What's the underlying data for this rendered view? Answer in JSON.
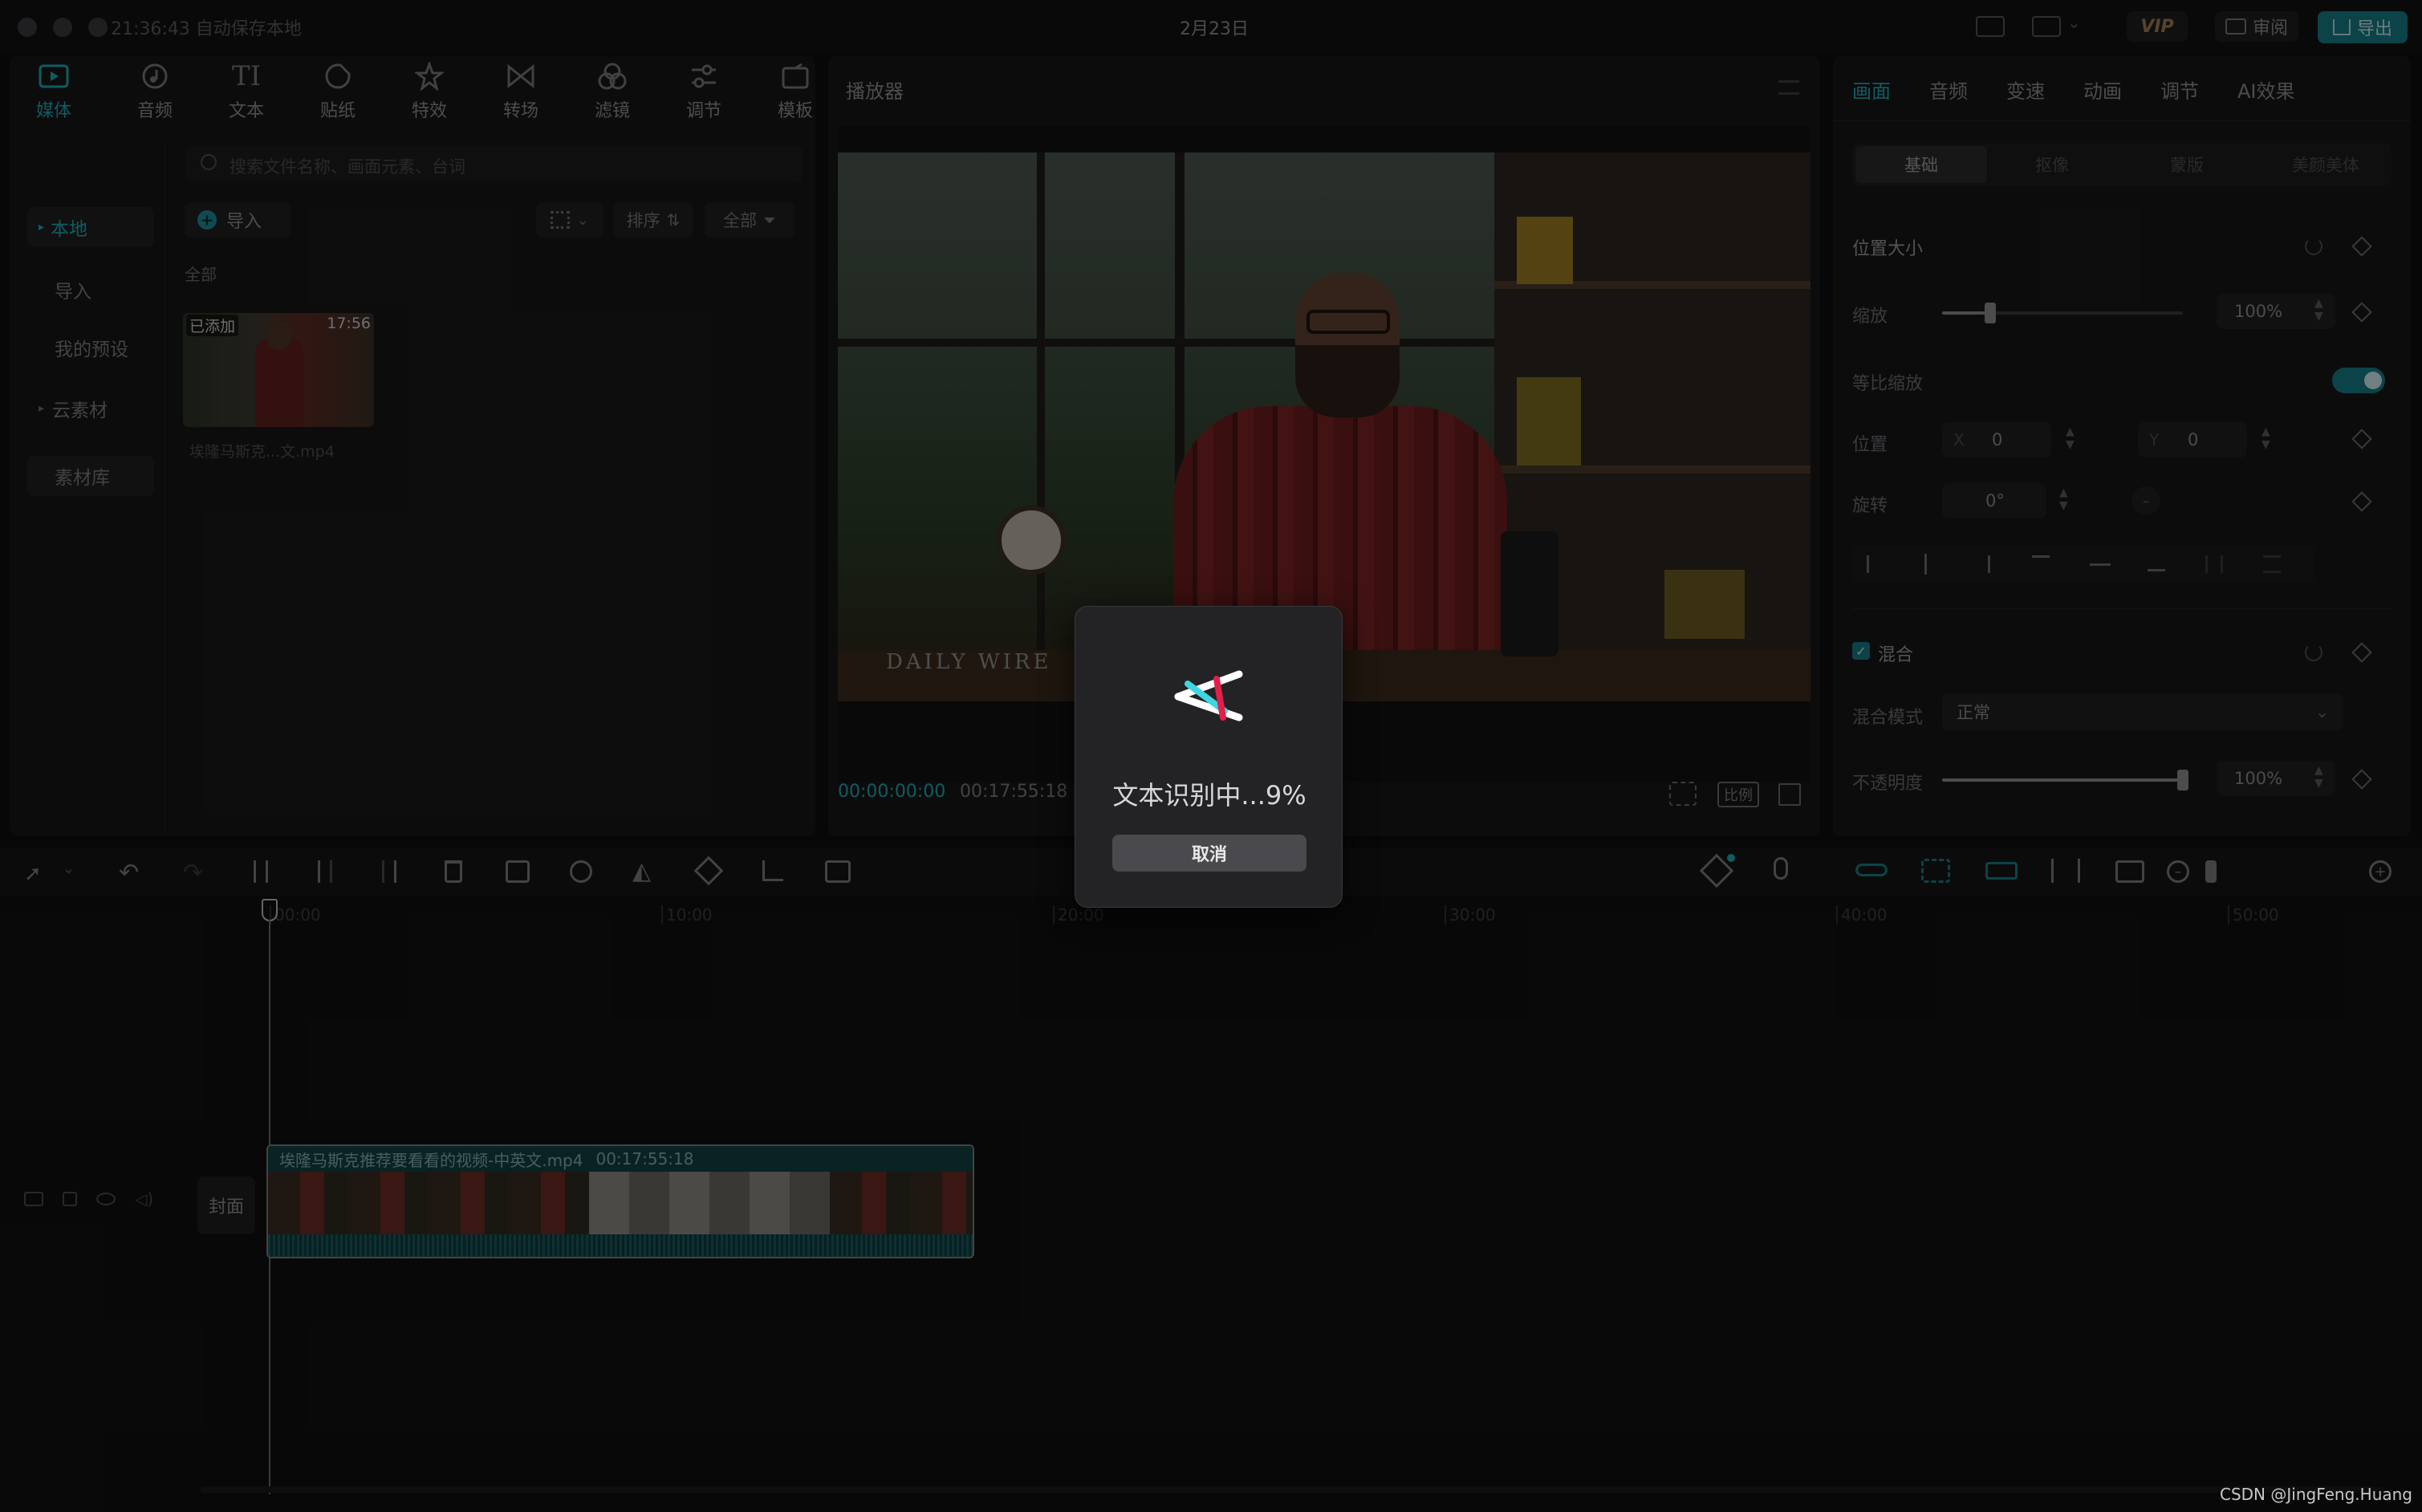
{
  "titlebar": {
    "autosave": "21:36:43 自动保存本地",
    "title": "2月23日",
    "vip": "VIP",
    "review": "审阅",
    "export": "导出"
  },
  "media_tabs": [
    {
      "label": "媒体",
      "icon": "media-icon"
    },
    {
      "label": "音频",
      "icon": "audio-icon"
    },
    {
      "label": "文本",
      "icon": "text-icon"
    },
    {
      "label": "贴纸",
      "icon": "sticker-icon"
    },
    {
      "label": "特效",
      "icon": "effects-icon"
    },
    {
      "label": "转场",
      "icon": "transition-icon"
    },
    {
      "label": "滤镜",
      "icon": "filter-icon"
    },
    {
      "label": "调节",
      "icon": "adjust-icon"
    },
    {
      "label": "模板",
      "icon": "template-icon"
    }
  ],
  "media_sidebar": {
    "local": "本地",
    "import": "导入",
    "presets": "我的预设",
    "cloud": "云素材",
    "library": "素材库"
  },
  "media_browser": {
    "search_placeholder": "搜索文件名称、画面元素、台词",
    "import_button": "导入",
    "sort": "排序",
    "filter": "全部",
    "section": "全部",
    "clip_badge": "已添加",
    "clip_duration": "17:56",
    "clip_name": "埃隆马斯克...文.mp4"
  },
  "player": {
    "title": "播放器",
    "current_time": "00:00:00:00",
    "total_time": "00:17:55:18",
    "ratio": "比例",
    "watermark": "DAILY WIRE"
  },
  "inspector": {
    "tabs": [
      "画面",
      "音频",
      "变速",
      "动画",
      "调节",
      "AI效果"
    ],
    "subtabs": [
      "基础",
      "抠像",
      "蒙版",
      "美颜美体"
    ],
    "section_position": "位置大小",
    "scale_label": "缩放",
    "scale_value": "100%",
    "scale_fraction": 0.2,
    "uniform_label": "等比缩放",
    "position_label": "位置",
    "x_label": "X",
    "x_value": "0",
    "y_label": "Y",
    "y_value": "0",
    "rotate_label": "旋转",
    "rotate_value": "0°",
    "section_blend": "混合",
    "blend_mode_label": "混合模式",
    "blend_mode_value": "正常",
    "opacity_label": "不透明度",
    "opacity_value": "100%",
    "opacity_fraction": 1.0
  },
  "timeline": {
    "ruler": [
      "00:00",
      "10:00",
      "20:00",
      "30:00",
      "40:00",
      "50:00"
    ],
    "cover_label": "封面",
    "clip_title": "埃隆马斯克推荐要看看的视频-中英文.mp4",
    "clip_duration": "00:17:55:18"
  },
  "dialog": {
    "status": "文本识别中...9%",
    "progress_percent": 9,
    "cancel": "取消"
  },
  "watermark": "CSDN @JingFeng.Huang",
  "colors": {
    "accent": "#1fa6b3",
    "background": "#0e0e0f",
    "panel": "#171718",
    "dialog": "#232325"
  }
}
